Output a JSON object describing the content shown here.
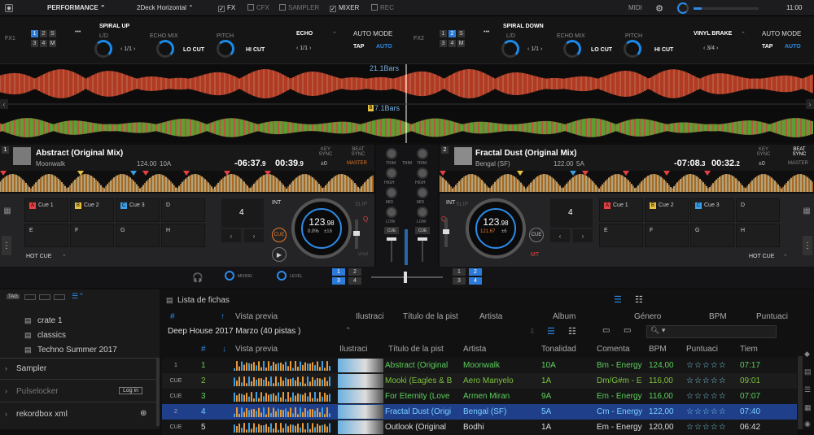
{
  "topbar": {
    "mode": "PERFORMANCE",
    "layout": "2Deck Horizontal",
    "fx": "FX",
    "cfx": "CFX",
    "sampler": "SAMPLER",
    "mixer": "MIXER",
    "rec": "REC",
    "midi": "MIDI",
    "time": "11:00"
  },
  "fx1": {
    "label": "FX1",
    "nums": [
      "1",
      "2",
      "3",
      "4",
      "M"
    ],
    "effect1": "SPIRAL UP",
    "sub1": "L/D",
    "beat": "1/1",
    "effect2": "ECHO MIX",
    "lowcut": "LO CUT",
    "pitch": "PITCH",
    "hicut": "HI CUT",
    "echo": "ECHO",
    "echo_beat": "1/1",
    "automode": "AUTO MODE",
    "tap": "TAP",
    "auto": "AUTO"
  },
  "fx2": {
    "label": "FX2",
    "nums": [
      "1",
      "2",
      "3",
      "4",
      "M"
    ],
    "effect1": "SPIRAL DOWN",
    "sub1": "L/D",
    "beat": "1/1",
    "effect2": "ECHO MIX",
    "lowcut": "LO CUT",
    "pitch": "PITCH",
    "hicut": "HI CUT",
    "brake": "VINYL BRAKE",
    "brake_beat": "3/4",
    "automode": "AUTO MODE",
    "tap": "TAP",
    "auto": "AUTO"
  },
  "wave": {
    "bars1": "21.1Bars",
    "bars2": "7.1Bars",
    "marker": "B"
  },
  "deck1": {
    "num": "1",
    "title": "Abstract (Original Mix)",
    "artist": "Moonwalk",
    "bpm": "124.00",
    "key": "10A",
    "remain": "-06:37",
    "remain_d": ".9",
    "elapsed": "00:39",
    "elapsed_d": ".9",
    "keysync": "KEY SYNC",
    "keyval": "±0",
    "beatsync": "BEAT SYNC",
    "master": "MASTER",
    "int": "INT",
    "slip": "SLIP",
    "q": "Q",
    "cue_btn": "CUE",
    "beatjump": "4",
    "jog_bpm": "123",
    "jog_bpm_d": ".98",
    "jog_pct": "0.0%",
    "jog_range": "±16",
    "vinyl": "vinyl",
    "hotcue": "HOT CUE",
    "pads": [
      {
        "k": "A",
        "c": "#e84040",
        "t": "Cue 1"
      },
      {
        "k": "B",
        "c": "#e8c040",
        "t": "Cue 2"
      },
      {
        "k": "C",
        "c": "#3aa0e8",
        "t": "Cue 3"
      },
      {
        "k": "",
        "c": "",
        "t": "D"
      },
      {
        "k": "",
        "c": "",
        "t": "E"
      },
      {
        "k": "",
        "c": "",
        "t": "F"
      },
      {
        "k": "",
        "c": "",
        "t": "G"
      },
      {
        "k": "",
        "c": "",
        "t": "H"
      }
    ]
  },
  "deck2": {
    "num": "2",
    "title": "Fractal Dust (Original Mix)",
    "artist": "Bengal (SF)",
    "bpm": "122.00",
    "key": "5A",
    "remain": "-07:08",
    "remain_d": ".3",
    "elapsed": "00:32",
    "elapsed_d": ".2",
    "keysync": "KEY SYNC",
    "keyval": "±0",
    "beatsync": "BEAT SYNC",
    "master": "MASTER",
    "int": "INT",
    "slip": "SLIP",
    "q": "Q",
    "cue_btn": "CUE",
    "beatjump": "4",
    "jog_bpm": "123",
    "jog_bpm_d": ".98",
    "jog_pct": "121.67",
    "jog_range": "±6",
    "mt": "MT",
    "hotcue": "HOT CUE",
    "pads": [
      {
        "k": "A",
        "c": "#e84040",
        "t": "Cue 1"
      },
      {
        "k": "B",
        "c": "#e8c040",
        "t": "Cue 2"
      },
      {
        "k": "C",
        "c": "#3aa0e8",
        "t": "Cue 3"
      },
      {
        "k": "",
        "c": "",
        "t": "D"
      },
      {
        "k": "",
        "c": "",
        "t": "E"
      },
      {
        "k": "",
        "c": "",
        "t": "F"
      },
      {
        "k": "",
        "c": "",
        "t": "G"
      },
      {
        "k": "",
        "c": "",
        "t": "H"
      }
    ]
  },
  "mixer": {
    "trim": "TRIM",
    "high": "HIGH",
    "mid": "MID",
    "low": "LOW",
    "cue": "CUE",
    "mixing": "MIXING",
    "level": "LEVEL",
    "ch": [
      "1",
      "2",
      "3",
      "4"
    ]
  },
  "browser": {
    "tag": "TAG",
    "tree": [
      "crate 1",
      "classics",
      "Techno Summer 2017"
    ],
    "sampler": "Sampler",
    "pulselocker": "Pulselocker",
    "login": "Log in",
    "rekordbox": "rekordbox xml",
    "list_title": "Lista de fichas",
    "playlist": "Deep House 2017 Marzo (40 pistas )",
    "hdr1": [
      "#",
      "Vista previa",
      "Ilustraci",
      "Título de la pist",
      "Artista",
      "Álbum",
      "Género",
      "BPM",
      "Puntuaci"
    ],
    "hdr2": [
      "#",
      "Vista previa",
      "Ilustraci",
      "Título de la pist",
      "Artista",
      "Tonalidad",
      "Comenta",
      "BPM",
      "Puntuaci",
      "Tiem"
    ],
    "rows": [
      {
        "deck": "1",
        "n": "1",
        "title": "Abstract (Original",
        "artist": "Moonwalk",
        "key": "10A",
        "comment": "Bm - Energy",
        "bpm": "124,00",
        "stars": "☆☆☆☆☆",
        "time": "07:17",
        "color": "#5cd05c",
        "sel": false
      },
      {
        "deck": "CUE",
        "n": "2",
        "title": "Mooki (Eagles & B",
        "artist": "Aero Manyelo",
        "key": "1A",
        "comment": "Dm/G#m - E",
        "bpm": "116,00",
        "stars": "☆☆☆☆☆",
        "time": "09:01",
        "color": "#7ac23a",
        "sel": false
      },
      {
        "deck": "CUE",
        "n": "3",
        "title": "For Eternity (Love",
        "artist": "Armen Miran",
        "key": "9A",
        "comment": "Em - Energy",
        "bpm": "116,00",
        "stars": "☆☆☆☆☆",
        "time": "07:07",
        "color": "#5cd05c",
        "sel": false
      },
      {
        "deck": "2",
        "n": "4",
        "title": "Fractal Dust (Origi",
        "artist": "Bengal (SF)",
        "key": "5A",
        "comment": "Cm - Energy",
        "bpm": "122,00",
        "stars": "☆☆☆☆☆",
        "time": "07:40",
        "color": "#7ad0ff",
        "sel": true
      },
      {
        "deck": "CUE",
        "n": "5",
        "title": "Outlook (Original",
        "artist": "Bodhi",
        "key": "1A",
        "comment": "Em - Energy",
        "bpm": "120,00",
        "stars": "☆☆☆☆☆",
        "time": "06:42",
        "color": "#ddd",
        "sel": false
      }
    ]
  }
}
